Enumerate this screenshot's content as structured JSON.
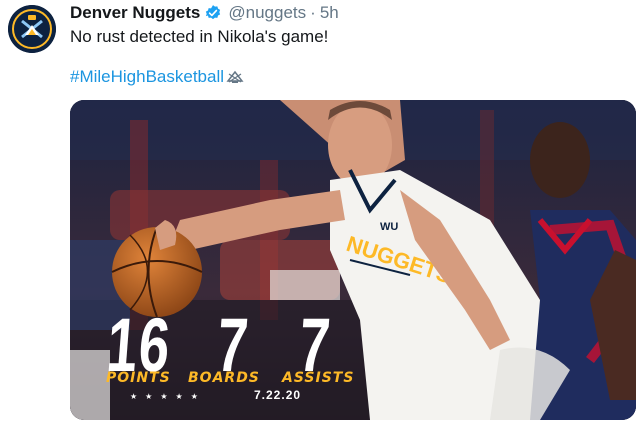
{
  "tweet": {
    "display_name": "Denver Nuggets",
    "handle": "@nuggets",
    "separator": "·",
    "time": "5h",
    "text": "No rust detected in Nikola's game!",
    "hashtag": "#MileHighBasketball"
  },
  "media": {
    "stats": [
      {
        "value": "16",
        "label": "POINTS"
      },
      {
        "value": "7",
        "label": "BOARDS"
      },
      {
        "value": "7",
        "label": "ASSISTS"
      }
    ],
    "stars": "★★★★★",
    "date": "7.22.20",
    "jersey_text": "NUGGETS",
    "jersey_patch": "WU"
  },
  "colors": {
    "accent_link": "#1b95e0",
    "nuggets_navy": "#0d2240",
    "nuggets_gold": "#fdb927",
    "verified_blue": "#1da1f2"
  },
  "icons": {
    "avatar": "nuggets-logo-icon",
    "verified": "verified-badge-icon",
    "hashtag_emoji": "nuggets-hashflag-icon"
  }
}
